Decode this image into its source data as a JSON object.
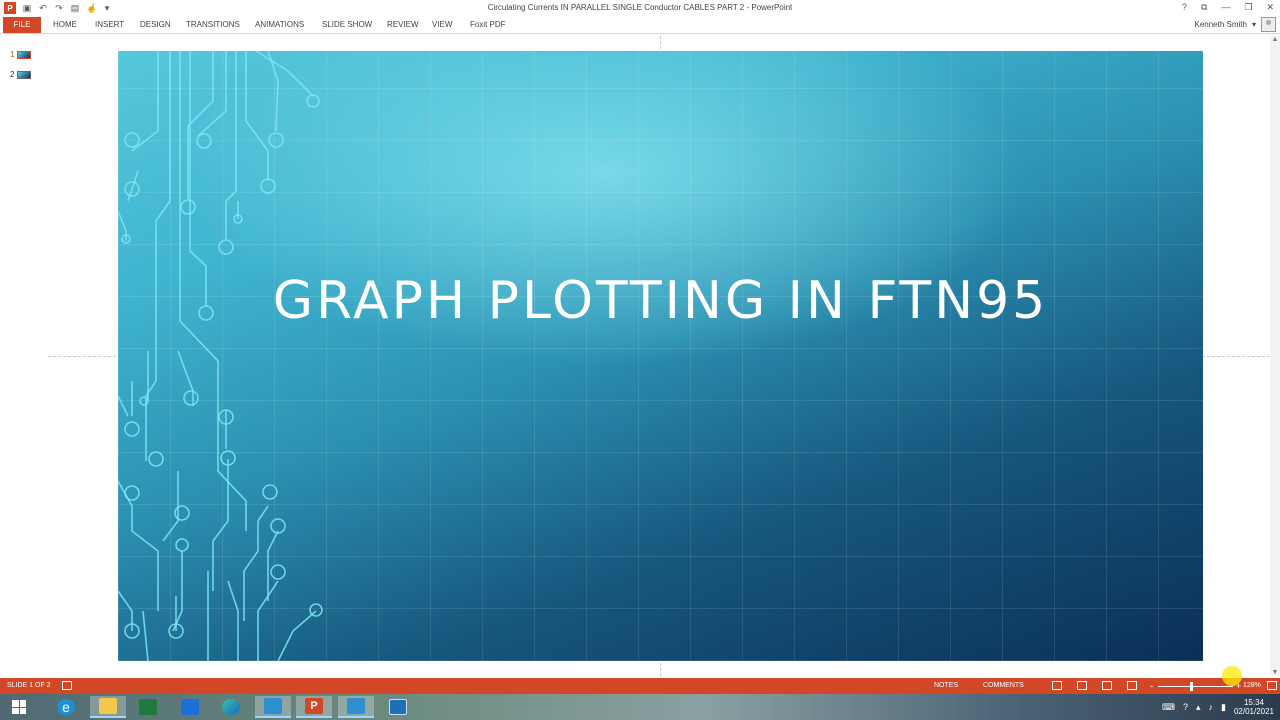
{
  "window": {
    "title": "Circulating Currents IN PARALLEL SINGLE Conductor CABLES PART 2 - PowerPoint",
    "app_logo": "P",
    "controls": [
      "?",
      "⧉",
      "—",
      "❐",
      "✕"
    ]
  },
  "ribbon": {
    "tabs": [
      "FILE",
      "HOME",
      "INSERT",
      "DESIGN",
      "TRANSITIONS",
      "ANIMATIONS",
      "SLIDE SHOW",
      "REVIEW",
      "VIEW",
      "Foxit PDF"
    ],
    "user_name": "Kenneth Smith"
  },
  "thumbnails": [
    {
      "number": "1",
      "active": true
    },
    {
      "number": "2",
      "active": false
    }
  ],
  "slide": {
    "title": "GRAPH PLOTTING IN FTN95"
  },
  "status": {
    "slide_info": "SLIDE 1 OF 2",
    "notes": "NOTES",
    "comments": "COMMENTS",
    "zoom_minus": "-",
    "zoom_plus": "+",
    "zoom_level": "128%",
    "zoom_fraction": 0.44
  },
  "taskbar": {
    "items": [
      "start",
      "edge-legacy",
      "file-explorer",
      "excel",
      "dropbox",
      "edge",
      "remote-desktop",
      "powerpoint",
      "remote-desktop-2",
      "recycle-bin"
    ],
    "time": "15:34",
    "date": "02/01/2021"
  },
  "colors": {
    "accent": "#d24726",
    "slide_top": "#56c8dc",
    "slide_bottom": "#0b2f57"
  }
}
